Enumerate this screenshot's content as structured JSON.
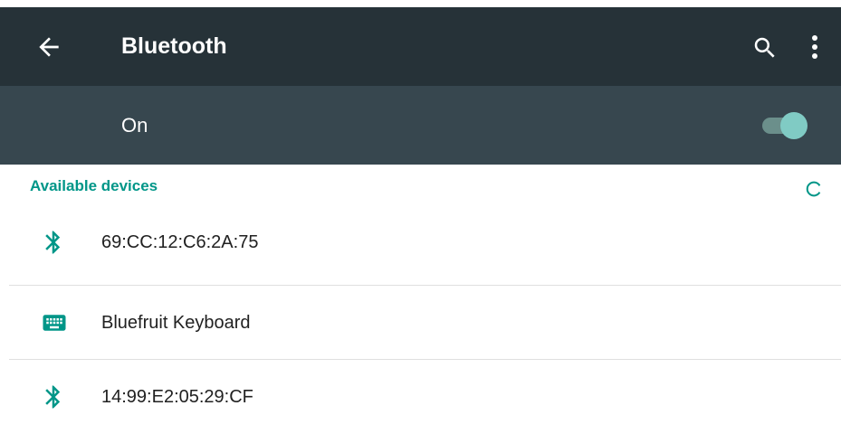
{
  "appbar": {
    "title": "Bluetooth",
    "back_icon": "arrow-back-icon",
    "search_icon": "search-icon",
    "more_icon": "more-vert-icon"
  },
  "switchbar": {
    "label": "On",
    "toggle_on": true
  },
  "section": {
    "title": "Available devices",
    "progress_icon": "refresh-spinner-icon"
  },
  "devices": [
    {
      "name": "69:CC:12:C6:2A:75",
      "icon": "bluetooth-icon"
    },
    {
      "name": "Bluefruit Keyboard",
      "icon": "keyboard-icon"
    },
    {
      "name": "14:99:E2:05:29:CF",
      "icon": "bluetooth-icon"
    }
  ],
  "colors": {
    "appbar_bg": "#263238",
    "switchbar_bg": "#37474f",
    "accent": "#009688",
    "toggle_thumb": "#80cbc4"
  }
}
